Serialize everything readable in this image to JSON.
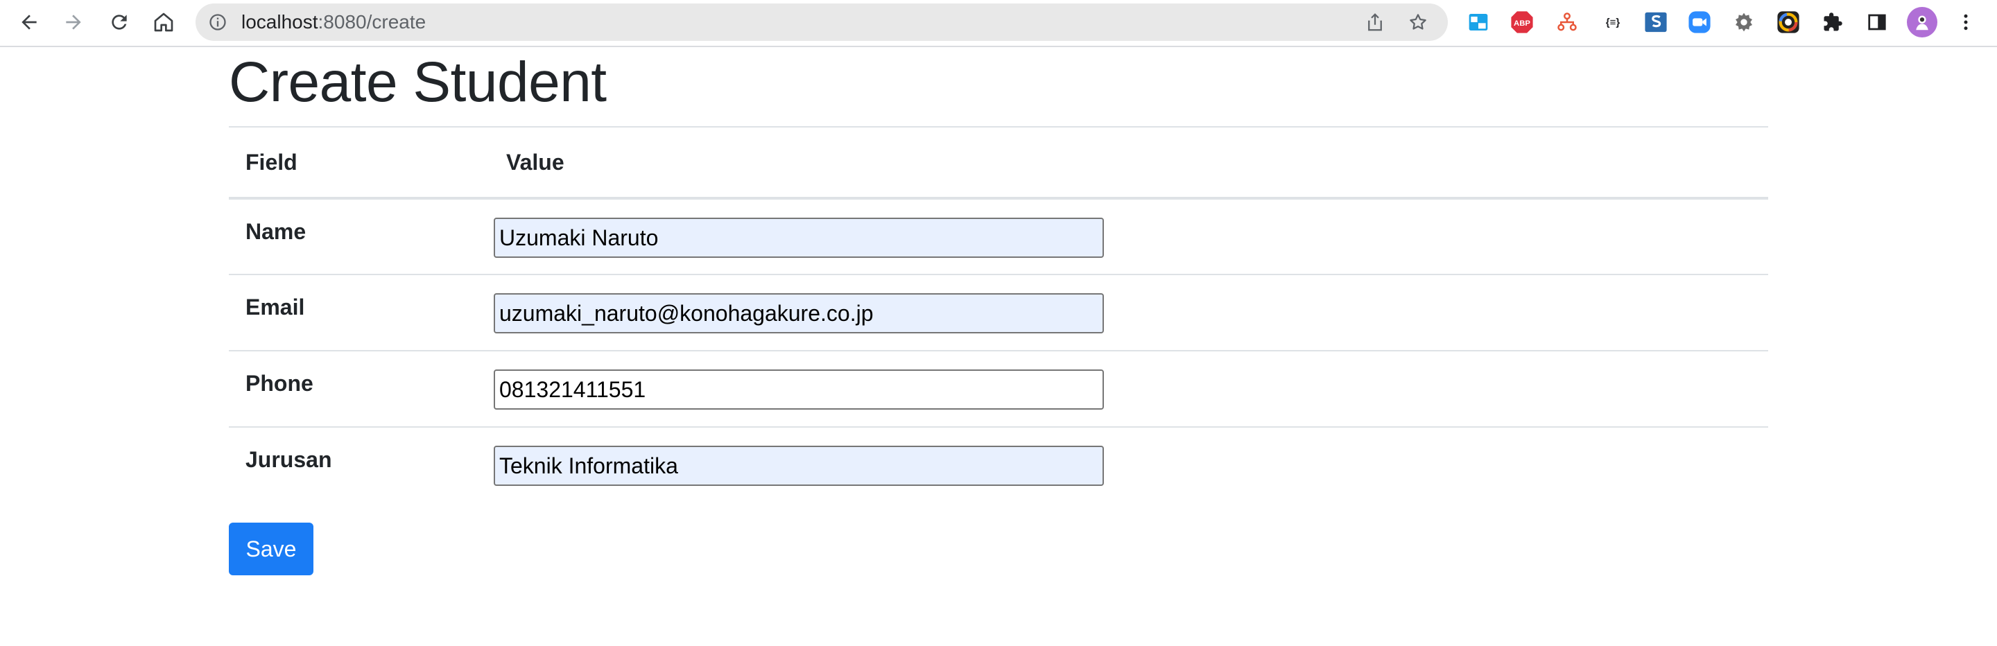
{
  "browser": {
    "url_host": "localhost",
    "url_rest": ":8080/create"
  },
  "page": {
    "title": "Create Student",
    "table": {
      "headers": [
        "Field",
        "Value"
      ],
      "rows": [
        {
          "label": "Name",
          "value": "Uzumaki Naruto"
        },
        {
          "label": "Email",
          "value": "uzumaki_naruto@konohagakure.co.jp"
        },
        {
          "label": "Phone",
          "value": "081321411551"
        },
        {
          "label": "Jurusan",
          "value": "Teknik Informatika"
        }
      ]
    },
    "save_label": "Save"
  },
  "extensions": {
    "abp_label": "ABP",
    "code_label": "{≡}"
  },
  "colors": {
    "primary": "#1a7cf5",
    "autofill_bg": "#e8f0fe"
  }
}
